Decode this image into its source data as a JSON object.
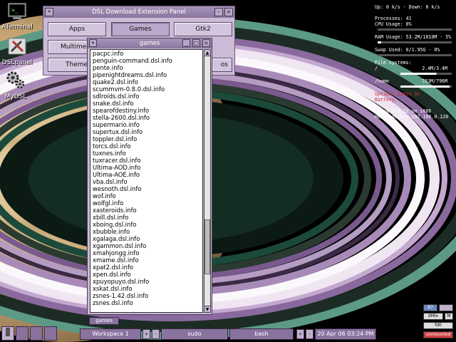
{
  "desktop": {
    "icons": [
      {
        "label": "ATerminal",
        "icon": "terminal-icon"
      },
      {
        "label": "DSLpanel",
        "icon": "tools-icon"
      },
      {
        "label": "MyDSL",
        "icon": "gears-icon"
      }
    ]
  },
  "conky": {
    "net": "Up: 0 k/s - Down: 0 k/s",
    "processes": "Processes: 41",
    "cpu": "CPU Usage: 0%",
    "ram": "RAM Usage: 53.2M/1010M - 5%",
    "swap": "Swap Used: 0/1.95G - 0%",
    "fs_title": "File systems:",
    "fs_root_path": "/",
    "fs_root_val": "2.4M/3.4M",
    "fs_home_path": "/home",
    "fs_home_val": "763M/796M",
    "uptime": "Uptime:   32min 9s",
    "battery": "Battery:",
    "kernel": "Linux 2.6.11 on i686",
    "host": "Host: dslbox 192.168.0.120",
    "ram_level": 0.05,
    "cpu_level": 0.0,
    "swap_level": 0.0,
    "fs_root_level": 0.7,
    "fs_home_level": 0.96
  },
  "panel": {
    "title": "DSL Download Extension Panel",
    "minimize": "-",
    "close": "×",
    "buttons": [
      "Apps",
      "Games",
      "Gtk2",
      "Multimedia",
      "Themes",
      "os"
    ],
    "active": "Games"
  },
  "games": {
    "title": "games",
    "menu_glyph": "•",
    "min_glyph": "_",
    "max_glyph": "□",
    "close_glyph": "×",
    "items": [
      "pacpc.info",
      "penguin-command.dsl.info",
      "pente.info",
      "pipenightdreams.dsl.info",
      "quake2.dsl.info",
      "scummvm-0.8.0.dsl.info",
      "sdlroids.dsl.info",
      "snake.dsl.info",
      "spearofdestiny.info",
      "stella-2600.dsl.info",
      "supermario.info",
      "supertux.dsl.info",
      "toppler.dsl.info",
      "torcs.dsl.info",
      "tuxnes.info",
      "tuxracer.dsl.info",
      "Ultima-AOD.info",
      "Ultima-AOE.info",
      "vba.dsl.info",
      "wesnoth.dsl.info",
      "wof.info",
      "wolfgl.info",
      "xasteroids.info",
      "xbill.dsl.info",
      "xboing.dsl.info",
      "xbubble.info",
      "xgalaga.dsl.info",
      "xgammon.dsl.info",
      "xmahjongg.info",
      "xmame.dsl.info",
      "xpat2.dsl.info",
      "xpen.dsl.info",
      "xpuyopuyo.dsl.info",
      "xskat.dsl.info",
      "zsnes-1.42.dsl.info",
      "zsnes.dsl.info"
    ],
    "scroll_up": "▲",
    "scroll_down": "▼",
    "scroll_position": 0.84,
    "taskbar_tab": "games"
  },
  "taskbar": {
    "workspace": "Workspace 1",
    "plus": "+",
    "minus": "-",
    "tasks": [
      "sudo",
      "bash"
    ],
    "clock": "20 Apr 06 03:24 PM"
  },
  "tray": {
    "top": "87",
    "dmix": "dMix",
    "mail": "M",
    "fd0": "fd0",
    "unmounted": "unmounted"
  },
  "colors": {
    "accent": "#8b76a0",
    "panel_bg": "#cbbbd6",
    "unmounted": "#d04040"
  }
}
